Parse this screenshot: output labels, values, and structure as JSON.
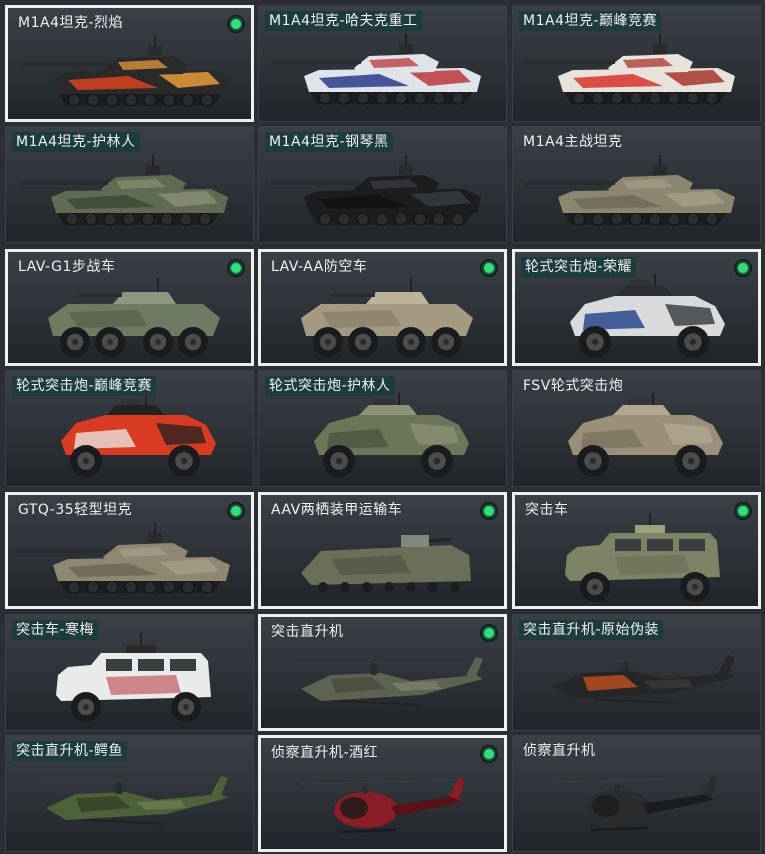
{
  "cards": [
    {
      "label": "M1A4坦克-烈焰",
      "selected": true,
      "equipped": true,
      "highlight": false,
      "type": "tank",
      "colors": [
        "#2a2a2a",
        "#d8431f",
        "#f2a23a"
      ]
    },
    {
      "label": "M1A4坦克-哈夫克重工",
      "selected": false,
      "equipped": false,
      "highlight": true,
      "type": "tank",
      "colors": [
        "#dfe3ea",
        "#2b3c8c",
        "#bb2a2f"
      ]
    },
    {
      "label": "M1A4坦克-巅峰竞赛",
      "selected": false,
      "equipped": false,
      "highlight": true,
      "type": "tank",
      "colors": [
        "#e6e2dc",
        "#d8342b",
        "#a52a22"
      ]
    },
    {
      "label": "M1A4坦克-护林人",
      "selected": false,
      "equipped": false,
      "highlight": true,
      "type": "tank",
      "colors": [
        "#5f6b52",
        "#3d4a37",
        "#8a9074"
      ]
    },
    {
      "label": "M1A4坦克-钢琴黑",
      "selected": false,
      "equipped": false,
      "highlight": true,
      "type": "tank",
      "colors": [
        "#1b1d1f",
        "#0f1011",
        "#3a3d40"
      ]
    },
    {
      "label": "M1A4主战坦克",
      "selected": false,
      "equipped": false,
      "highlight": false,
      "type": "tank",
      "colors": [
        "#8a8670",
        "#6e6b58",
        "#a4a088"
      ]
    },
    {
      "label": "LAV-G1步战车",
      "selected": true,
      "equipped": true,
      "highlight": false,
      "type": "ifv",
      "colors": [
        "#6e7a62",
        "#56604c",
        "#8d9780"
      ]
    },
    {
      "label": "LAV-AA防空车",
      "selected": true,
      "equipped": true,
      "highlight": false,
      "type": "ifv",
      "colors": [
        "#a49a82",
        "#877e68",
        "#bcb39b"
      ]
    },
    {
      "label": "轮式突击炮-荣耀",
      "selected": true,
      "equipped": true,
      "highlight": true,
      "type": "assault",
      "colors": [
        "#d8dadc",
        "#1f3f8a",
        "#2a2d31"
      ]
    },
    {
      "label": "轮式突击炮-巅峰竞赛",
      "selected": false,
      "equipped": false,
      "highlight": true,
      "type": "assault",
      "colors": [
        "#d93a22",
        "#e8e4df",
        "#222"
      ]
    },
    {
      "label": "轮式突击炮-护林人",
      "selected": false,
      "equipped": false,
      "highlight": true,
      "type": "assault",
      "colors": [
        "#6d7559",
        "#4c5540",
        "#8b9275"
      ]
    },
    {
      "label": "FSV轮式突击炮",
      "selected": false,
      "equipped": false,
      "highlight": false,
      "type": "assault",
      "colors": [
        "#9a907a",
        "#7a725f",
        "#b2a891"
      ]
    },
    {
      "label": "GTQ-35轻型坦克",
      "selected": true,
      "equipped": true,
      "highlight": false,
      "type": "lighttank",
      "colors": [
        "#8e8872",
        "#6d6854",
        "#a59f88"
      ]
    },
    {
      "label": "AAV两栖装甲运输车",
      "selected": true,
      "equipped": true,
      "highlight": false,
      "type": "aav",
      "colors": [
        "#6b6f5a",
        "#545847",
        "#84887a"
      ]
    },
    {
      "label": "突击车",
      "selected": true,
      "equipped": true,
      "highlight": false,
      "type": "mrap",
      "colors": [
        "#7d8466",
        "#626850",
        "#9aa080"
      ]
    },
    {
      "label": "突击车-寒梅",
      "selected": false,
      "equipped": false,
      "highlight": true,
      "type": "mrap",
      "colors": [
        "#e9eaea",
        "#b31f27",
        "#2a2a2a"
      ]
    },
    {
      "label": "突击直升机",
      "selected": true,
      "equipped": true,
      "highlight": false,
      "type": "heli",
      "colors": [
        "#5e6250",
        "#45483b",
        "#7b7f6c"
      ]
    },
    {
      "label": "突击直升机-原始伪装",
      "selected": false,
      "equipped": false,
      "highlight": true,
      "type": "heli",
      "colors": [
        "#262626",
        "#d9561f",
        "#3a3a3a"
      ]
    },
    {
      "label": "突击直升机-鳄鱼",
      "selected": false,
      "equipped": false,
      "highlight": true,
      "type": "heli",
      "colors": [
        "#4d6238",
        "#2f3d23",
        "#6c8050"
      ]
    },
    {
      "label": "侦察直升机-酒红",
      "selected": true,
      "equipped": true,
      "highlight": false,
      "type": "scout",
      "colors": [
        "#8a1d26",
        "#5a1218",
        "#2a2a2a"
      ]
    },
    {
      "label": "侦察直升机",
      "selected": false,
      "equipped": false,
      "highlight": false,
      "type": "scout",
      "colors": [
        "#2b2c2d",
        "#1b1c1d",
        "#4a4c4e"
      ]
    }
  ]
}
